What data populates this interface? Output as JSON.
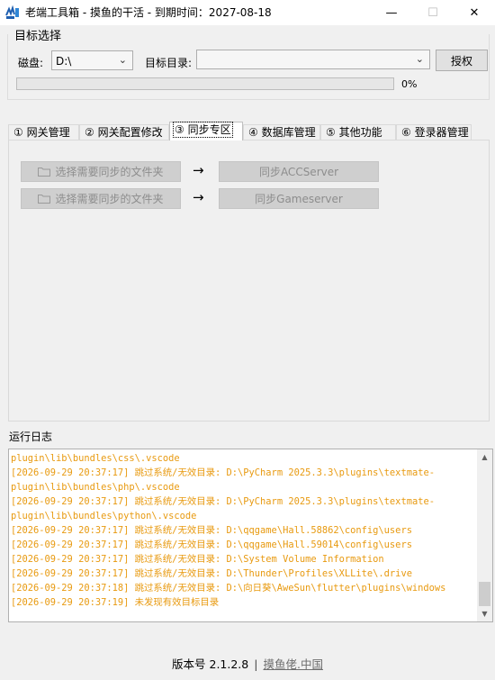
{
  "window": {
    "title": "老端工具箱 - 摸鱼的干活 - 到期时间：2027-08-18",
    "minimize": "—",
    "maximize": "☐",
    "close": "✕"
  },
  "target": {
    "group_title": "目标选择",
    "disk_label": "磁盘:",
    "disk_value": "D:\\",
    "dir_label": "目标目录:",
    "dir_value": "",
    "auth_button": "授权",
    "progress_text": "0%",
    "progress_value": 0
  },
  "tabs": [
    {
      "label": "① 网关管理",
      "active": false
    },
    {
      "label": "② 网关配置修改",
      "active": false
    },
    {
      "label": "③ 同步专区",
      "active": true
    },
    {
      "label": "④ 数据库管理",
      "active": false
    },
    {
      "label": "⑤ 其他功能",
      "active": false
    },
    {
      "label": "⑥ 登录器管理",
      "active": false
    }
  ],
  "sync": {
    "row1": {
      "select_label": "选择需要同步的文件夹",
      "arrow": "→",
      "action_label": "同步ACCServer"
    },
    "row2": {
      "select_label": "选择需要同步的文件夹",
      "arrow": "→",
      "action_label": "同步Gameserver"
    }
  },
  "log": {
    "title": "运行日志",
    "lines": [
      "plugin\\lib\\bundles\\css\\.vscode",
      "[2026-09-29 20:37:17] 跳过系统/无效目录: D:\\PyCharm 2025.3.3\\plugins\\textmate-",
      "plugin\\lib\\bundles\\php\\.vscode",
      "[2026-09-29 20:37:17] 跳过系统/无效目录: D:\\PyCharm 2025.3.3\\plugins\\textmate-",
      "plugin\\lib\\bundles\\python\\.vscode",
      "[2026-09-29 20:37:17] 跳过系统/无效目录: D:\\qqgame\\Hall.58862\\config\\users",
      "[2026-09-29 20:37:17] 跳过系统/无效目录: D:\\qqgame\\Hall.59014\\config\\users",
      "[2026-09-29 20:37:17] 跳过系统/无效目录: D:\\System Volume Information",
      "[2026-09-29 20:37:17] 跳过系统/无效目录: D:\\Thunder\\Profiles\\XLLite\\.drive",
      "[2026-09-29 20:37:18] 跳过系统/无效目录: D:\\向日葵\\AweSun\\flutter\\plugins\\windows",
      "[2026-09-29 20:37:19] 未发现有效目标目录"
    ]
  },
  "footer": {
    "version": "版本号 2.1.2.8",
    "separator": "|",
    "link": "摸鱼佬.中国"
  },
  "colors": {
    "log_text": "#e89a10",
    "progress_fill": "#06b025",
    "disabled_button": "#cfcfcf"
  },
  "icons": [
    "app-icon",
    "folder-icon",
    "chevron-down-icon",
    "minimize-icon",
    "maximize-icon",
    "close-icon"
  ]
}
